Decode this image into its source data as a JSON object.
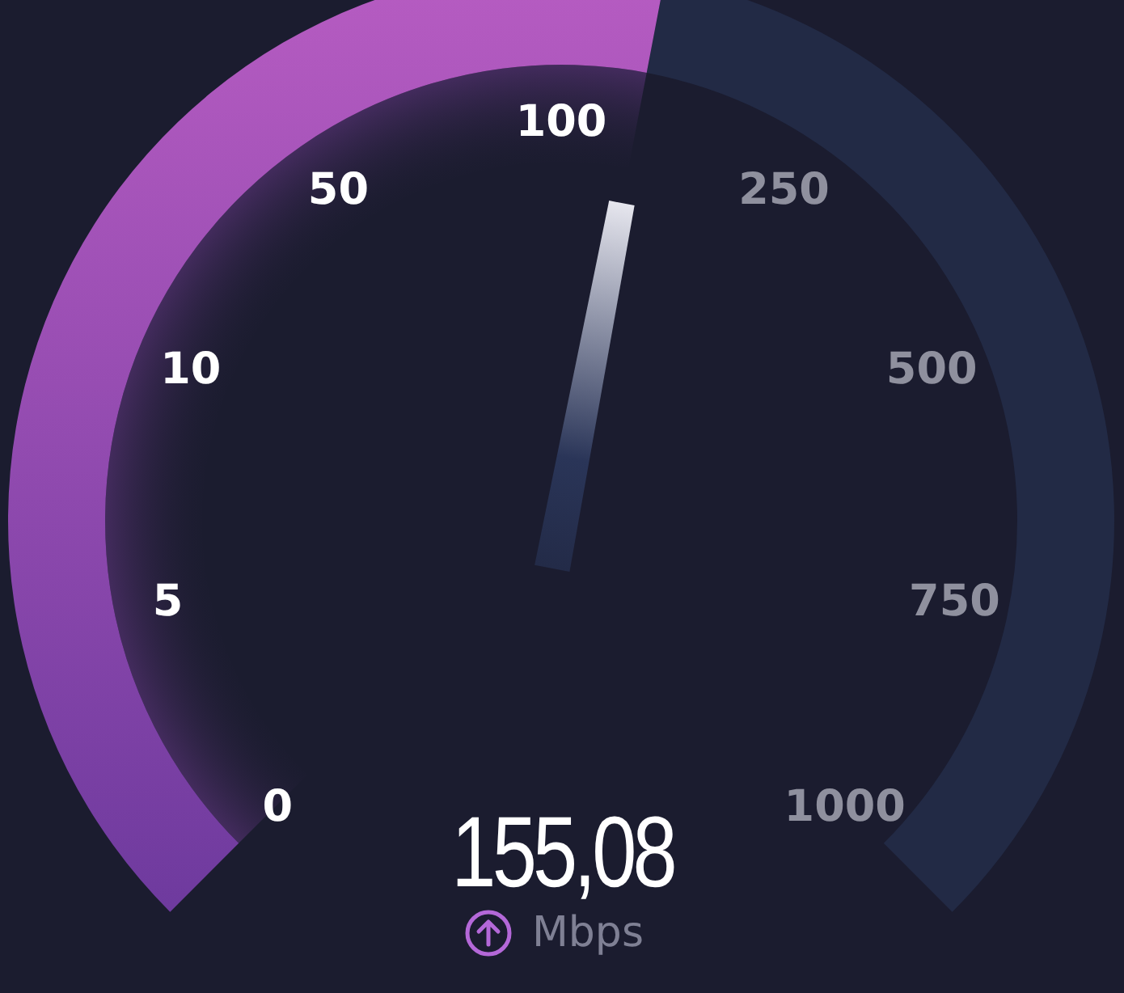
{
  "gauge": {
    "ticks": [
      {
        "label": "0",
        "reached": true
      },
      {
        "label": "5",
        "reached": true
      },
      {
        "label": "10",
        "reached": true
      },
      {
        "label": "50",
        "reached": true
      },
      {
        "label": "100",
        "reached": true
      },
      {
        "label": "250",
        "reached": false
      },
      {
        "label": "500",
        "reached": false
      },
      {
        "label": "750",
        "reached": false
      },
      {
        "label": "1000",
        "reached": false
      }
    ]
  },
  "reading": {
    "value": "155,08",
    "unit": "Mbps"
  }
}
